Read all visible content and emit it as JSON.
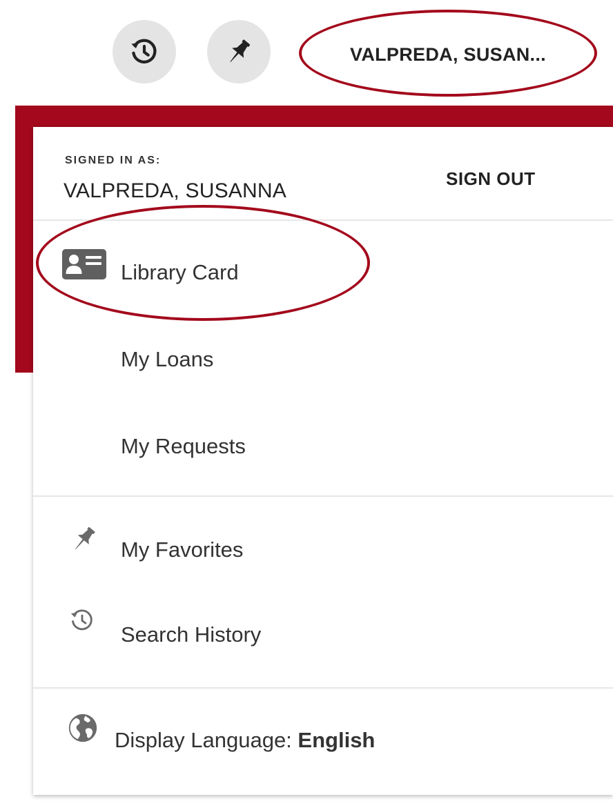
{
  "toolbar": {
    "user_menu_label": "VALPREDA, SUSAN..."
  },
  "menu": {
    "signed_in_caption": "SIGNED IN AS:",
    "signed_in_name": "VALPREDA, SUSANNA",
    "sign_out_label": "SIGN OUT",
    "items": [
      {
        "id": "library-card",
        "label": "Library Card",
        "icon": "id-card-icon"
      },
      {
        "id": "my-loans",
        "label": "My Loans"
      },
      {
        "id": "my-requests",
        "label": "My Requests"
      },
      {
        "id": "my-favorites",
        "label": "My Favorites",
        "icon": "pin-icon"
      },
      {
        "id": "search-history",
        "label": "Search History",
        "icon": "history-icon"
      }
    ],
    "display_language": {
      "label": "Display Language:",
      "value": "English",
      "icon": "globe-icon"
    }
  },
  "colors": {
    "brand_red": "#a3081c",
    "button_gray": "#e4e4e4",
    "text": "#333333"
  }
}
